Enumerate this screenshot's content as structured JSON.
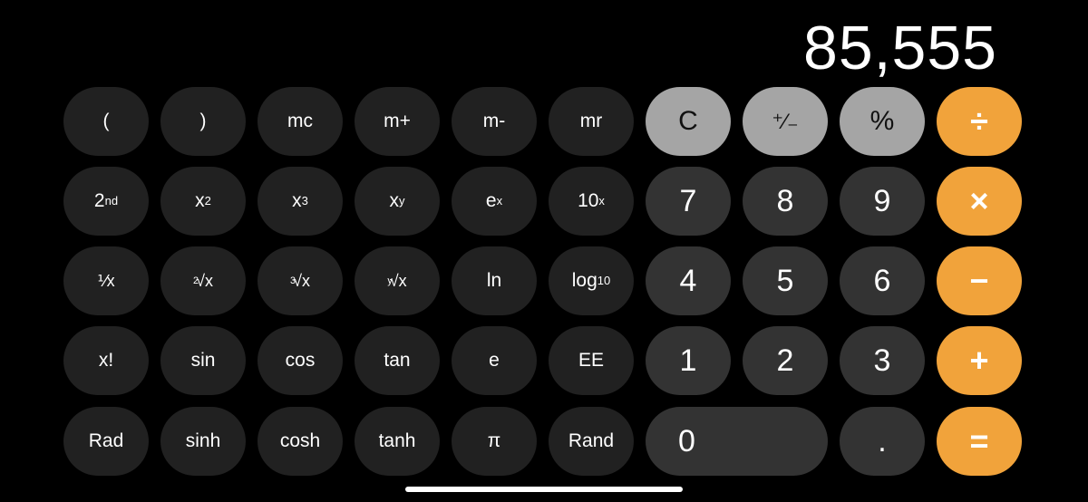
{
  "display": {
    "value": "85,555"
  },
  "colors": {
    "operator": "#f1a33b",
    "function": "#a5a5a5",
    "number": "#333333",
    "scientific": "#212121",
    "background": "#000000"
  },
  "scientific_keys": {
    "open_paren": "(",
    "close_paren": ")",
    "mc": "mc",
    "m_plus": "m+",
    "m_minus": "m-",
    "mr": "mr",
    "second": {
      "base": "2",
      "sup": "nd"
    },
    "x_squared": {
      "base": "x",
      "sup": "2"
    },
    "x_cubed": {
      "base": "x",
      "sup": "3"
    },
    "x_pow_y": {
      "base": "x",
      "sup": "y"
    },
    "e_pow_x": {
      "base": "e",
      "sup": "x"
    },
    "ten_pow_x": {
      "base": "10",
      "sup": "x"
    },
    "reciprocal": "⅟x",
    "sqrt2": {
      "index": "2",
      "radical": "√x"
    },
    "sqrt3": {
      "index": "3",
      "radical": "√x"
    },
    "sqrty": {
      "index": "y",
      "radical": "√x"
    },
    "ln": "ln",
    "log10": {
      "base": "log",
      "sub": "10"
    },
    "factorial": "x!",
    "sin": "sin",
    "cos": "cos",
    "tan": "tan",
    "e": "e",
    "ee": "EE",
    "rad": "Rad",
    "sinh": "sinh",
    "cosh": "cosh",
    "tanh": "tanh",
    "pi": "π",
    "rand": "Rand"
  },
  "function_keys": {
    "clear": "C",
    "sign": "⁺∕₋",
    "percent": "%"
  },
  "operator_keys": {
    "divide": "÷",
    "multiply": "×",
    "subtract": "−",
    "add": "+",
    "equals": "="
  },
  "digit_keys": {
    "d7": "7",
    "d8": "8",
    "d9": "9",
    "d4": "4",
    "d5": "5",
    "d6": "6",
    "d1": "1",
    "d2": "2",
    "d3": "3",
    "d0": "0",
    "decimal": "."
  }
}
